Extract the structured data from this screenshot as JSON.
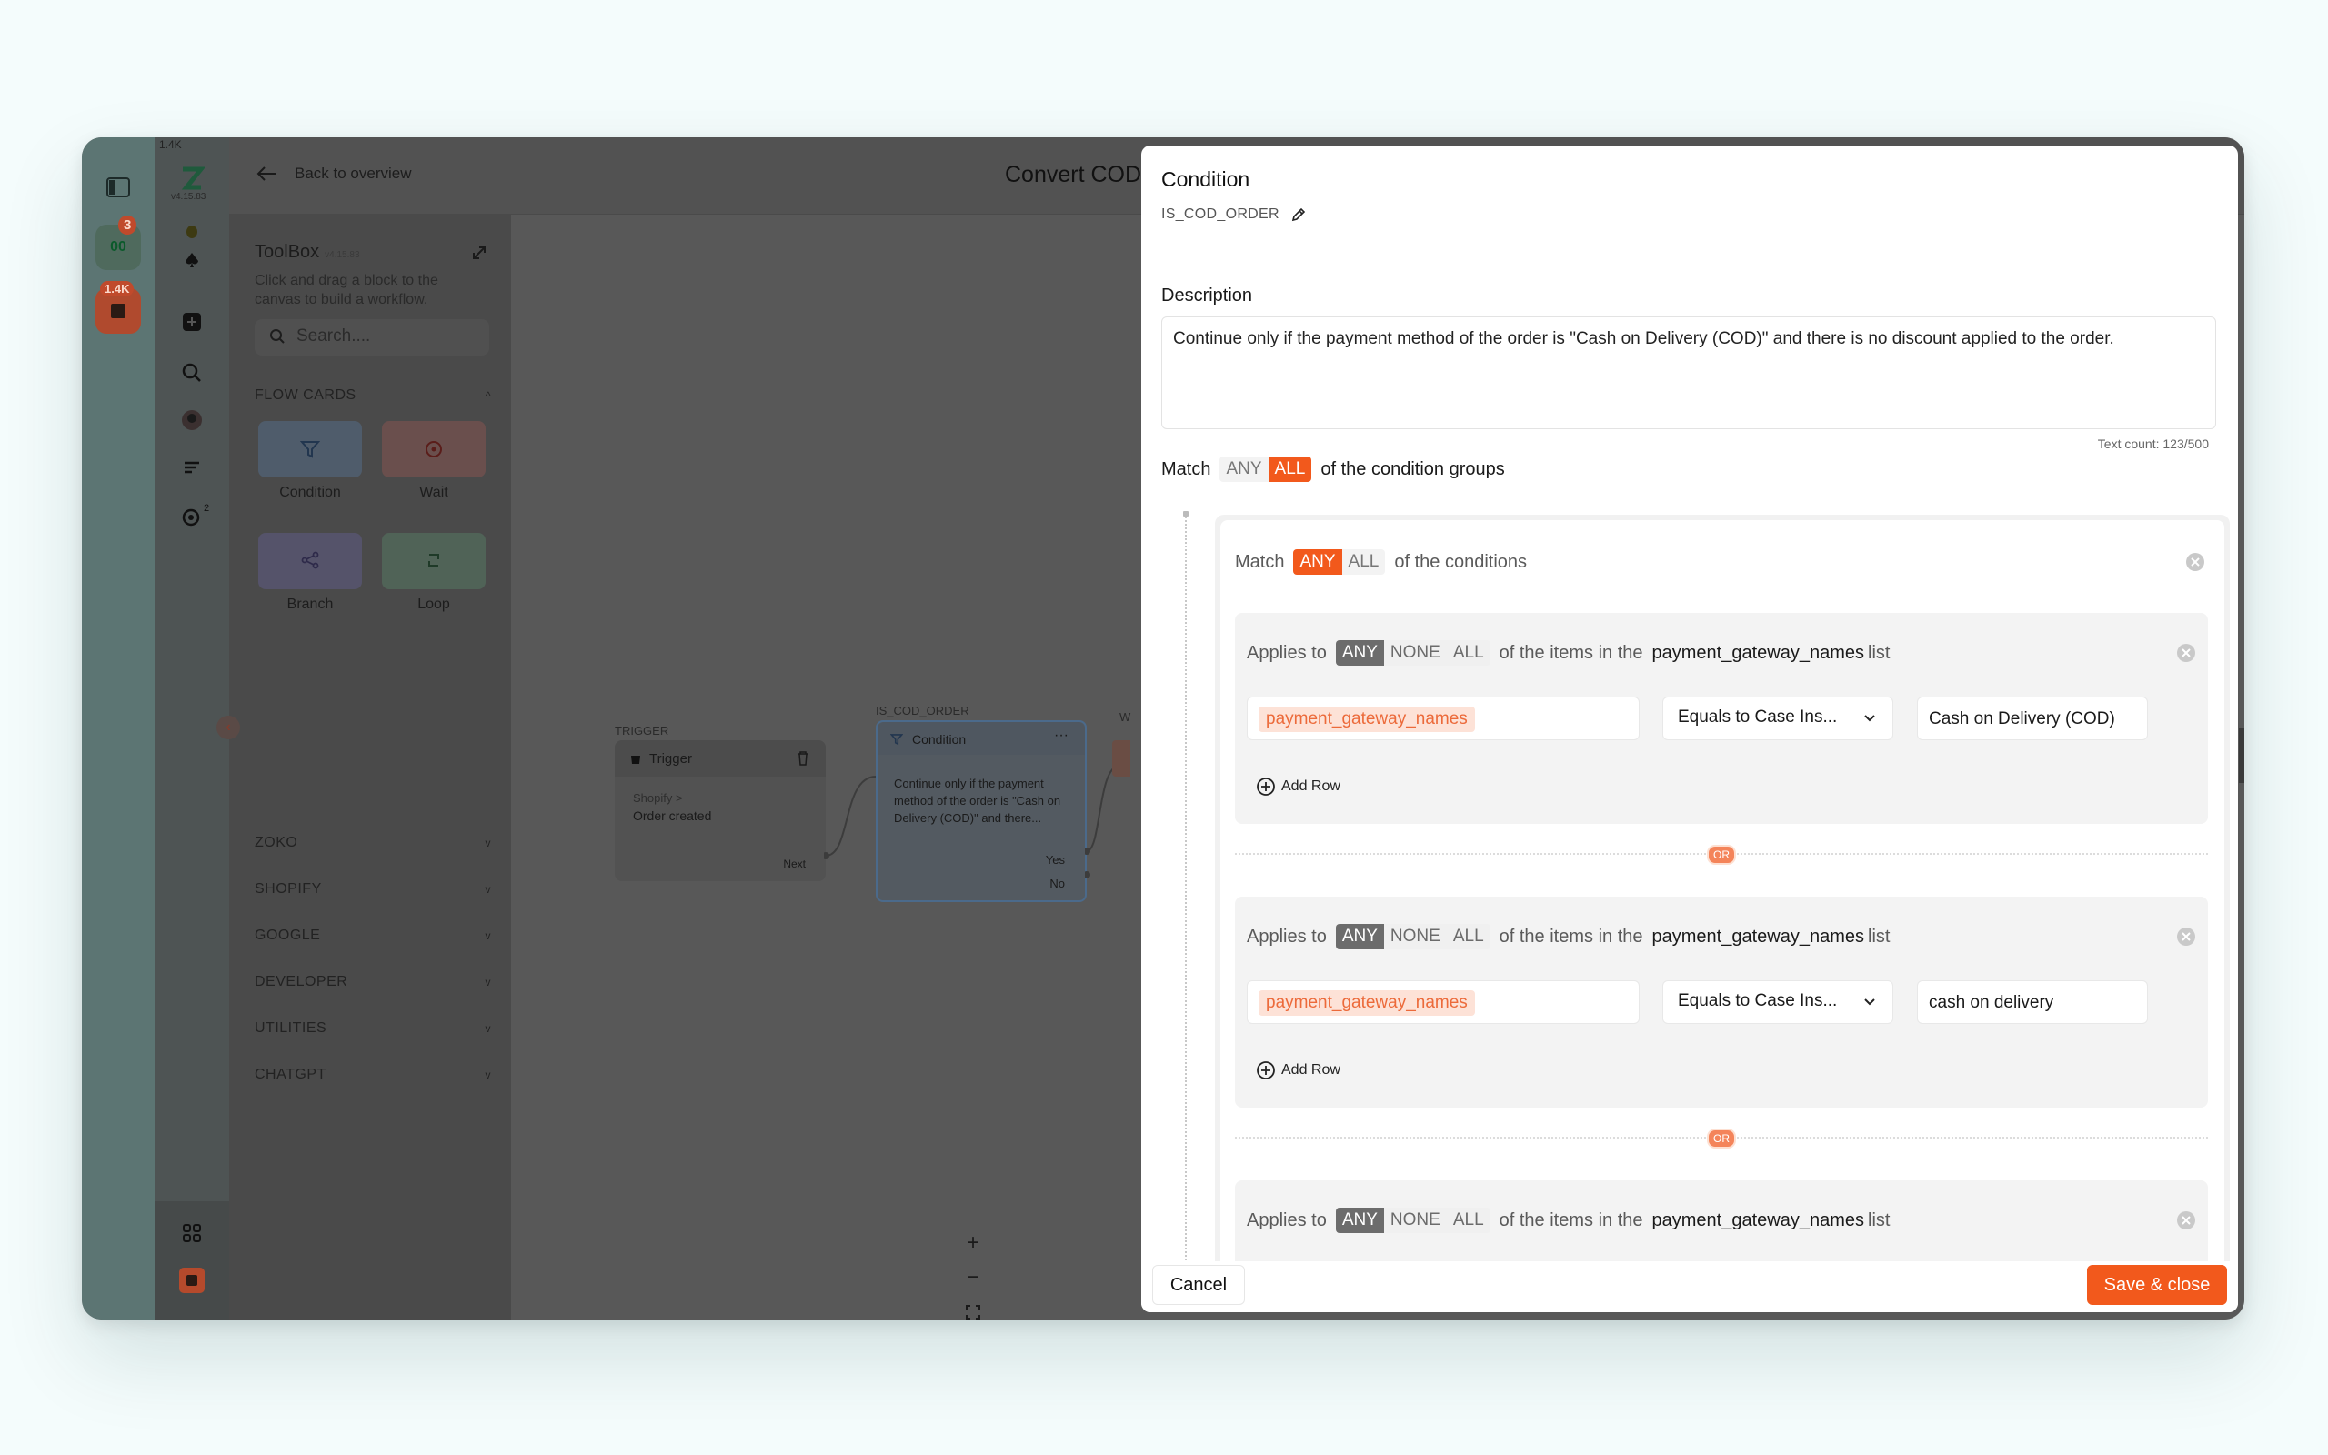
{
  "app": {
    "back_label": "Back to overview",
    "flow_title": "Convert COD",
    "logo_version": "v4.15.83",
    "rail_badges": {
      "count_label": "00",
      "count_badge": "3",
      "inbox_badge": "1.4K",
      "rail2_badge": "1.4K",
      "rail2_sup": "2"
    }
  },
  "toolbox": {
    "title": "ToolBox",
    "version": "v4.15.83",
    "subtitle": "Click and drag a block to the canvas to build a workflow.",
    "search_placeholder": "Search....",
    "flow_cards_label": "FLOW CARDS",
    "cards": [
      {
        "label": "Condition",
        "icon": "filter-icon",
        "color": "#9fb9d6"
      },
      {
        "label": "Wait",
        "icon": "timer-icon",
        "color": "#d89490"
      },
      {
        "label": "Branch",
        "icon": "branch-icon",
        "color": "#a4a0c2"
      },
      {
        "label": "Loop",
        "icon": "loop-icon",
        "color": "#9ec6a8"
      }
    ],
    "sections": [
      "ZOKO",
      "SHOPIFY",
      "GOOGLE",
      "DEVELOPER",
      "UTILITIES",
      "CHATGPT"
    ]
  },
  "canvas": {
    "trigger_label": "TRIGGER",
    "trigger_title": "Trigger",
    "trigger_source": "Shopify >",
    "trigger_event": "Order created",
    "trigger_next": "Next",
    "cond_key": "IS_COD_ORDER",
    "cond_title": "Condition",
    "cond_text": "Continue only if the payment method of the order is \"Cash on Delivery (COD)\" and there...",
    "cond_yes": "Yes",
    "cond_no": "No",
    "next_node_label": "W"
  },
  "modal": {
    "title": "Condition",
    "key": "IS_COD_ORDER",
    "description_label": "Description",
    "description": "Continue only if the payment method of the order is \"Cash on Delivery (COD)\" and there is no discount applied to the order.",
    "text_count": "Text count: 123/500",
    "match_prefix": "Match",
    "match_any": "ANY",
    "match_all": "ALL",
    "match_suffix": "of the condition groups",
    "match_selected": "ALL",
    "group": {
      "match_prefix": "Match",
      "any": "ANY",
      "all": "ALL",
      "suffix": "of the conditions",
      "selected": "ANY"
    },
    "conditions": [
      {
        "applies_prefix": "Applies to",
        "any": "ANY",
        "none": "NONE",
        "all": "ALL",
        "mid": "of the items in the",
        "list_name": "payment_gateway_names",
        "list_suffix": "list",
        "field_tag": "payment_gateway_names",
        "operator": "Equals to Case Ins...",
        "value": "Cash on Delivery (COD)",
        "add_row": "Add Row"
      },
      {
        "applies_prefix": "Applies to",
        "any": "ANY",
        "none": "NONE",
        "all": "ALL",
        "mid": "of the items in the",
        "list_name": "payment_gateway_names",
        "list_suffix": "list",
        "field_tag": "payment_gateway_names",
        "operator": "Equals to Case Ins...",
        "value": "cash on delivery",
        "add_row": "Add Row"
      },
      {
        "applies_prefix": "Applies to",
        "any": "ANY",
        "none": "NONE",
        "all": "ALL",
        "mid": "of the items in the",
        "list_name": "payment_gateway_names",
        "list_suffix": "list"
      }
    ],
    "or_label": "OR",
    "cancel": "Cancel",
    "save": "Save & close"
  },
  "colors": {
    "accent": "#f2591c",
    "tag_bg": "#fde2d7",
    "tag_text": "#ec6a3a"
  }
}
